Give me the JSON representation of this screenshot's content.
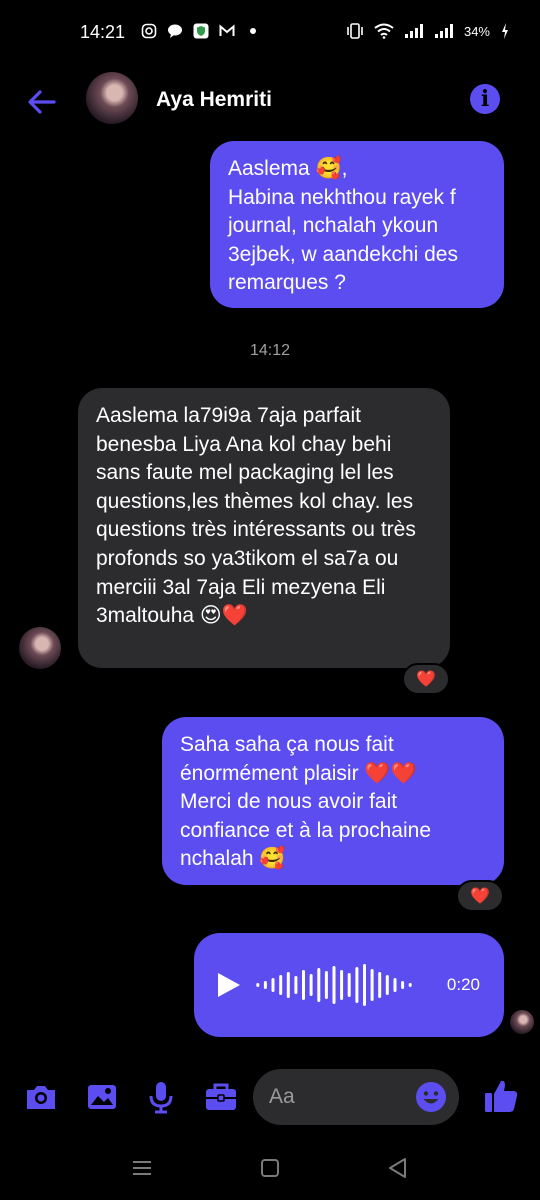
{
  "status_bar": {
    "time": "14:21",
    "battery": "34%",
    "left_icons": [
      "instagram-icon",
      "chat-bubble-icon",
      "shield-app-icon",
      "mail-icon",
      "dot-icon"
    ],
    "right_icons": [
      "vibrate-icon",
      "wifi-icon",
      "signal-icon",
      "signal-icon",
      "battery-icon"
    ]
  },
  "header": {
    "contact_name": "Aya Hemriti",
    "back_icon": "arrow-left-icon",
    "info_icon": "info-icon",
    "accent_color": "#5c4df0"
  },
  "messages": [
    {
      "direction": "sent",
      "text": "Aaslema 🥰,\nHabina nekhthou rayek f journal, nchalah ykoun 3ejbek, w aandekchi des remarques ?"
    },
    {
      "direction": "received",
      "text": "Aaslema la79i9a 7aja parfait benesba Liya Ana kol chay behi sans faute mel packaging lel les questions,les thèmes kol chay. les questions très intéressants ou très profonds so ya3tikom el sa7a ou merciii 3al 7aja Eli mezyena Eli 3maltouha 😍❤️",
      "reaction": "❤️"
    },
    {
      "direction": "sent",
      "text": "Saha saha ça nous fait énormément plaisir ❤️❤️\nMerci de nous avoir fait confiance et à la prochaine nchalah 🥰",
      "reaction": "❤️"
    }
  ],
  "timestamp": "14:12",
  "voice_message": {
    "duration": "0:20",
    "play_icon": "play-icon"
  },
  "composer": {
    "placeholder": "Aa",
    "tools": [
      "camera-icon",
      "image-icon",
      "microphone-icon",
      "briefcase-icon"
    ],
    "emoji_icon": "smiley-icon",
    "like_icon": "thumbs-up-icon"
  },
  "nav_bar": [
    "menu-icon",
    "home-square-icon",
    "back-triangle-icon"
  ]
}
